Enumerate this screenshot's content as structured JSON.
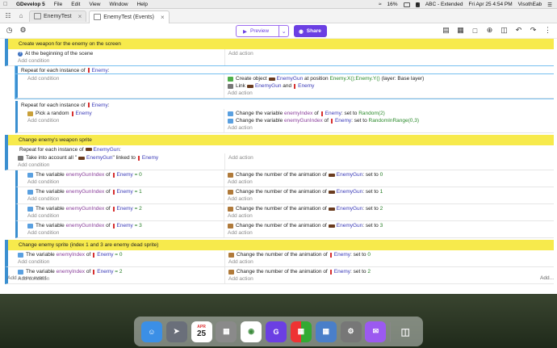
{
  "menubar": {
    "app_name": "GDevelop 5",
    "items": [
      "File",
      "Edit",
      "View",
      "Window",
      "Help"
    ],
    "battery": "16%",
    "input_source": "A",
    "input_label": "ABC - Extended",
    "clock": "Fri Apr 25  4:54 PM",
    "user": "VisothEab"
  },
  "tabs": [
    {
      "label": "EnemyTest",
      "active": false
    },
    {
      "label": "EnemyTest (Events)",
      "active": true
    }
  ],
  "toolbar": {
    "preview_label": "Preview",
    "share_label": "Share"
  },
  "events": {
    "add_condition": "Add condition",
    "add_action": "Add action",
    "group1_title": "Create weapon for the enemy on the screen",
    "e1_cond": "At the beginning of the scene",
    "e2_repeat_prefix": "Repeat for each instance of",
    "e2_repeat_obj": "Enemy",
    "e2_repeat_suffix": ":",
    "e2_act1_a": "Create object",
    "e2_act1_obj": "EnemyGun",
    "e2_act1_b": "at position",
    "e2_act1_x": "Enemy.X()",
    "e2_act1_sep": ";",
    "e2_act1_y": "Enemy.Y()",
    "e2_act1_c": "(layer: Base layer)",
    "e2_act2_a": "Link",
    "e2_act2_obj1": "EnemyGun",
    "e2_act2_b": "and",
    "e2_act2_obj2": "Enemy",
    "e3_repeat_prefix": "Repeat for each instance of",
    "e3_repeat_obj": "Enemy",
    "e3_repeat_suffix": ":",
    "e3_cond_a": "Pick a random",
    "e3_cond_obj": "Enemy",
    "e3_act1_a": "Change the variable",
    "e3_act1_var": "enemyIndex",
    "e3_act1_b": "of",
    "e3_act1_obj": "Enemy",
    "e3_act1_c": ": set to",
    "e3_act1_val": "Random(2)",
    "e3_act2_a": "Change the variable",
    "e3_act2_var": "enemyGunIndex",
    "e3_act2_b": "of",
    "e3_act2_obj": "Enemy",
    "e3_act2_c": ": set to",
    "e3_act2_val": "RandomInRange(0,3)",
    "group2_title": "Change enemy's weapon sprite",
    "e4_repeat_prefix": "Repeat for each instance of",
    "e4_repeat_obj": "EnemyGun",
    "e4_repeat_suffix": ":",
    "e4_cond_a": "Take into account all \"",
    "e4_cond_obj1": "EnemyGun",
    "e4_cond_b": "\" linked to",
    "e4_cond_obj2": "Enemy",
    "var_prefix": "The variable",
    "of": "of",
    "anim_action": "Change the number of the animation of",
    "set_to": ": set to",
    "gun_rows": [
      {
        "var": "enemyGunIndex",
        "obj": "Enemy",
        "op": "= 0",
        "aobj": "EnemyGun",
        "aval": "0"
      },
      {
        "var": "enemyGunIndex",
        "obj": "Enemy",
        "op": "= 1",
        "aobj": "EnemyGun",
        "aval": "1"
      },
      {
        "var": "enemyGunIndex",
        "obj": "Enemy",
        "op": "= 2",
        "aobj": "EnemyGun",
        "aval": "2"
      },
      {
        "var": "enemyGunIndex",
        "obj": "Enemy",
        "op": "= 3",
        "aobj": "EnemyGun",
        "aval": "3"
      }
    ],
    "group3_title": "Change enemy sprite (index 1 and 3 are enemy dead sprite)",
    "enemy_rows": [
      {
        "var": "enemyIndex",
        "obj": "Enemy",
        "op": "= 0",
        "aobj": "Enemy",
        "aval": "0"
      },
      {
        "var": "enemyIndex",
        "obj": "Enemy",
        "op": "= 2",
        "aobj": "Enemy",
        "aval": "2"
      }
    ],
    "add_new_event": "Add a new event",
    "add_more": "Add..."
  },
  "dock": {
    "calendar_month": "APR",
    "calendar_day": "25"
  }
}
